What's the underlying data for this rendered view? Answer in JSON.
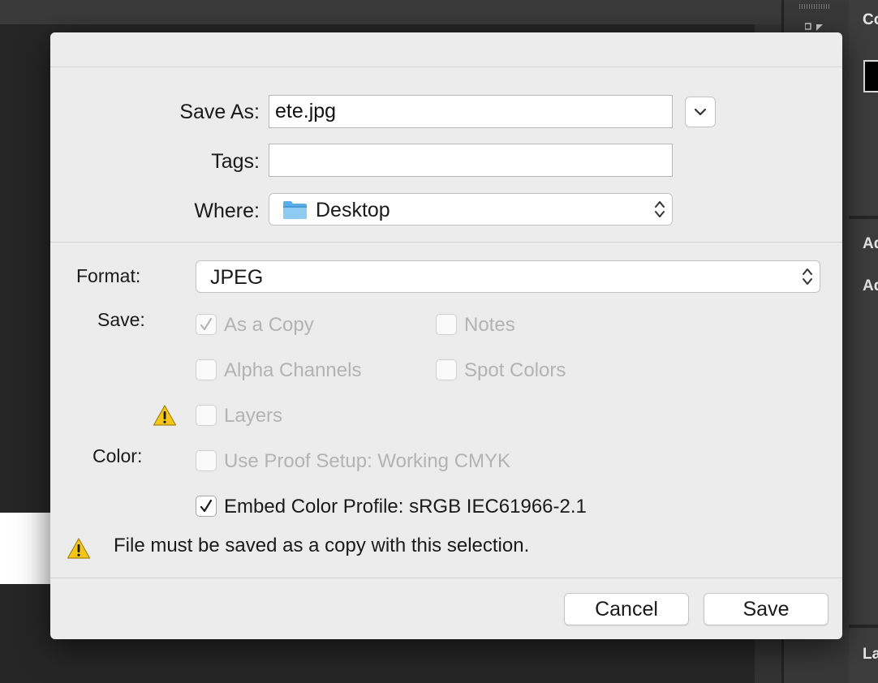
{
  "dialog": {
    "save_as_label": "Save As:",
    "save_as_value": "ete.jpg",
    "tags_label": "Tags:",
    "tags_value": "",
    "where_label": "Where:",
    "where_value": "Desktop",
    "format_label": "Format:",
    "format_value": "JPEG",
    "save_label": "Save:",
    "color_label": "Color:",
    "options": {
      "as_a_copy": {
        "label": "As a Copy",
        "checked": true,
        "enabled": false
      },
      "notes": {
        "label": "Notes",
        "checked": false,
        "enabled": false
      },
      "alpha_channels": {
        "label": "Alpha Channels",
        "checked": false,
        "enabled": false
      },
      "spot_colors": {
        "label": "Spot Colors",
        "checked": false,
        "enabled": false
      },
      "layers": {
        "label": "Layers",
        "checked": false,
        "enabled": false
      },
      "use_proof_setup": {
        "label": "Use Proof Setup:  Working CMYK",
        "checked": false,
        "enabled": false
      },
      "embed_color_profile": {
        "label": "Embed Color Profile:  sRGB IEC61966-2.1",
        "checked": true,
        "enabled": true
      }
    },
    "warning_message": "File must be saved as a copy with this selection.",
    "cancel_label": "Cancel",
    "save_button_label": "Save"
  },
  "background": {
    "panel_labels": [
      "Co",
      "Ad",
      "Ad",
      "La"
    ]
  },
  "colors": {
    "dialog_bg": "#ececec",
    "warning_yellow": "#f5c518",
    "folder_blue": "#5aaee8",
    "app_bg": "#282828"
  },
  "icons": {
    "chevron": "chevron-down-icon",
    "folder": "folder-icon",
    "updown": "updown-arrows-icon",
    "warning": "warning-triangle-icon",
    "check": "checkmark-icon"
  }
}
